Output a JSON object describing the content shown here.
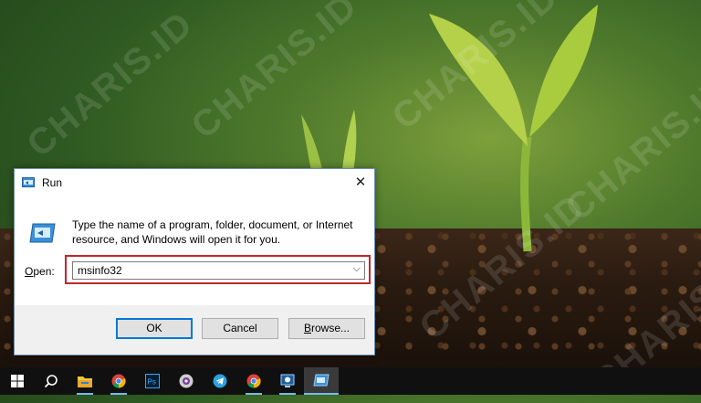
{
  "watermark_text": "CHARIS.ID",
  "dialog": {
    "title": "Run",
    "close_label": "✕",
    "description": "Type the name of a program, folder, document, or Internet resource, and Windows will open it for you.",
    "open_label_prefix": "O",
    "open_label_rest": "pen:",
    "input_value": "msinfo32",
    "ok_label": "OK",
    "cancel_label": "Cancel",
    "browse_label_prefix": "B",
    "browse_label_rest": "rowse..."
  },
  "taskbar": {
    "items": [
      {
        "name": "start-icon"
      },
      {
        "name": "search-icon"
      },
      {
        "name": "file-explorer-icon"
      },
      {
        "name": "chrome-icon"
      },
      {
        "name": "photoshop-icon"
      },
      {
        "name": "media-player-icon"
      },
      {
        "name": "telegram-icon"
      },
      {
        "name": "chrome-icon"
      },
      {
        "name": "remote-desktop-icon"
      },
      {
        "name": "run-icon"
      }
    ]
  },
  "colors": {
    "highlight": "#c1272d",
    "accent": "#0078d7",
    "taskbar": "#101010"
  }
}
